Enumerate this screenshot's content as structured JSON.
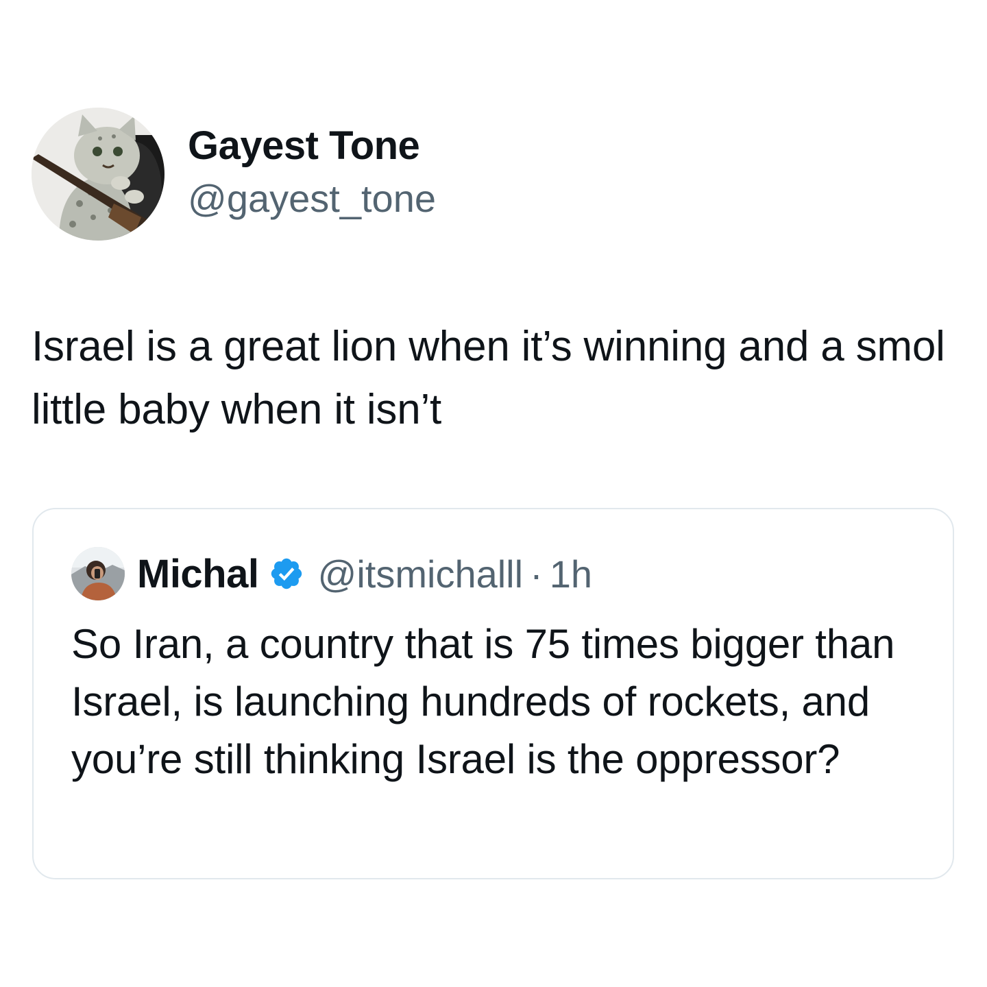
{
  "tweet": {
    "author": {
      "display_name": "Gayest Tone",
      "handle": "@gayest_tone",
      "avatar_icon": "cat-with-rifle-drawing"
    },
    "text": "Israel is a great lion when it’s winning and a smol little baby when it isn’t"
  },
  "quoted_tweet": {
    "author": {
      "display_name": "Michal",
      "handle": "@itsmichalll",
      "verified": true,
      "verified_icon": "verified-badge-icon",
      "avatar_icon": "person-photo"
    },
    "separator": "·",
    "time": "1h",
    "text": "So Iran, a country that is 75 times bigger than Israel, is launching hundreds of rockets, and you’re still thinking Israel is the oppressor?"
  },
  "colors": {
    "text_primary": "#0f1419",
    "text_secondary": "#536471",
    "verified_blue": "#1d9bf0",
    "border": "#e1e8ed"
  }
}
